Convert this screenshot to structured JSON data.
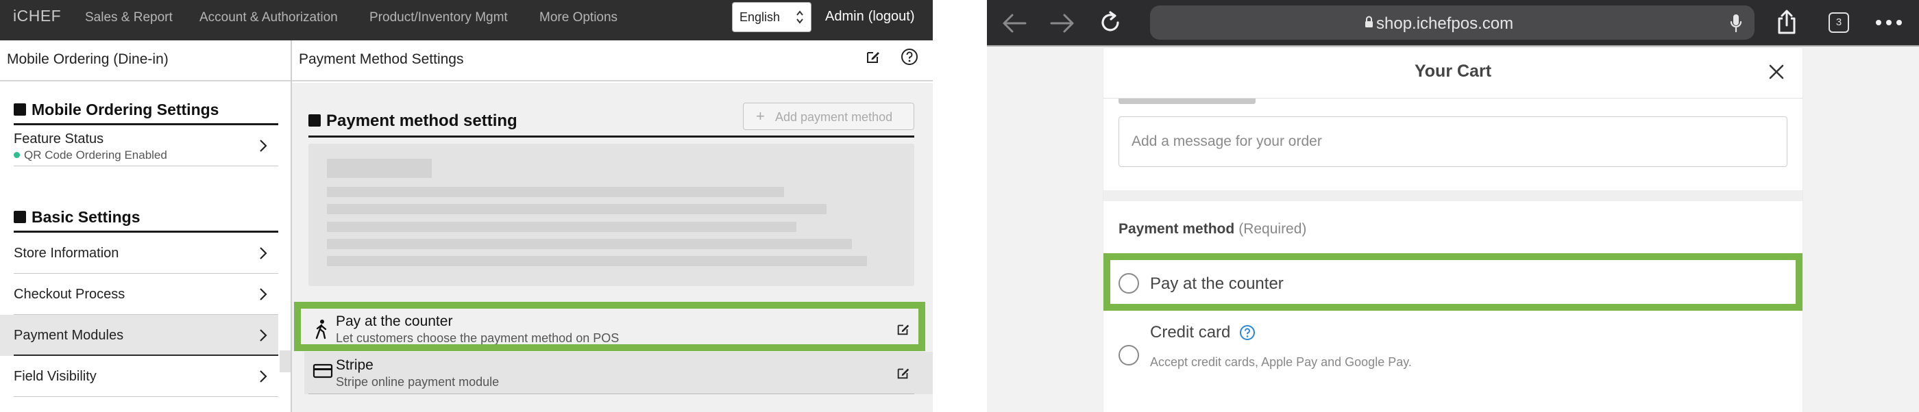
{
  "left": {
    "logo": "iCHEF",
    "nav": [
      "Sales & Report",
      "Account & Authorization",
      "Product/Inventory Mgmt",
      "More Options"
    ],
    "language": {
      "selected": "English"
    },
    "admin": {
      "name": "Admin",
      "logout": "(logout)"
    },
    "sub_header": {
      "left_title": "Mobile Ordering (Dine-in)",
      "right_title": "Payment Method Settings"
    },
    "sidebar": {
      "section1": {
        "title": "Mobile Ordering Settings"
      },
      "feature_status": {
        "label": "Feature Status",
        "status": "QR Code Ordering Enabled"
      },
      "section2": {
        "title": "Basic Settings"
      },
      "items": [
        {
          "label": "Store Information"
        },
        {
          "label": "Checkout Process"
        },
        {
          "label": "Payment Modules"
        },
        {
          "label": "Field Visibility"
        }
      ]
    },
    "main": {
      "title": "Payment method setting",
      "add_button": "Add payment method",
      "methods": [
        {
          "name": "Pay at the counter",
          "desc": "Let customers choose the payment method on POS"
        },
        {
          "name": "Stripe",
          "desc": "Stripe online payment module"
        }
      ]
    },
    "colors": {
      "highlight": "#7ab648",
      "status_dot": "#2fbf8f",
      "topbar": "#2f2f2f"
    }
  },
  "right": {
    "browser": {
      "url": "shop.ichefpos.com",
      "tab_count": "3"
    },
    "cart": {
      "title": "Your Cart",
      "message_placeholder": "Add a message for your order",
      "payment_label": "Payment method",
      "payment_required": "(Required)",
      "options": [
        {
          "name": "Pay at the counter"
        },
        {
          "name": "Credit card",
          "desc": "Accept credit cards, Apple Pay and Google Pay."
        }
      ]
    }
  }
}
